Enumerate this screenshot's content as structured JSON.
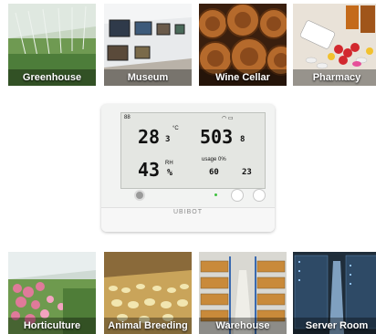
{
  "top_tiles": [
    {
      "label": "Greenhouse"
    },
    {
      "label": "Museum"
    },
    {
      "label": "Wine Cellar"
    },
    {
      "label": "Pharmacy"
    }
  ],
  "bottom_tiles": [
    {
      "label": "Horticulture"
    },
    {
      "label": "Animal Breeding"
    },
    {
      "label": "Warehouse"
    },
    {
      "label": "Server Room"
    }
  ],
  "device": {
    "brand": "UBIBOT",
    "temperature": "28",
    "temperature_decimal": "3",
    "temperature_unit": "°C",
    "humidity": "43",
    "humidity_unit": "%",
    "humidity_label": "RH",
    "co2": "503",
    "co2_decimal": "8",
    "storage_label": "usage",
    "storage_value": "0%",
    "secondary_humidity": "60",
    "secondary_temp": "23",
    "status_left": "88",
    "led_color": "#3ec13e"
  }
}
